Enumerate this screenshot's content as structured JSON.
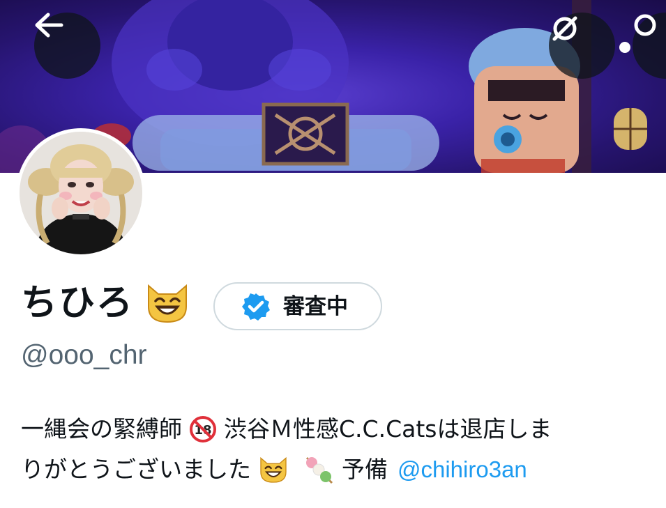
{
  "header": {
    "back_icon": "arrow-left-icon",
    "offline_icon": "offline-slash-icon",
    "search_icon": "search-icon"
  },
  "profile": {
    "display_name": "ちひろ",
    "name_emoji": "smiling-cat-emoji",
    "badge_label": "審査中",
    "badge_icon": "verified-check-icon",
    "handle": "@ooo_chr"
  },
  "bio": {
    "line1_part1": "一縄会の緊縛師",
    "line1_icon": "no-under-18-emoji",
    "line1_part2": "渋谷Ｍ性感C.C.Catsは退店しま",
    "line2_part1": "りがとうございました",
    "line2_icon1": "smiling-cat-emoji",
    "line2_icon2": "dango-emoji",
    "line2_part2": "予備",
    "mention": "@chihiro3an"
  },
  "colors": {
    "text": "#0f1419",
    "secondary_text": "#536471",
    "link": "#1d9bf0",
    "badge_border": "#cfd9de"
  }
}
